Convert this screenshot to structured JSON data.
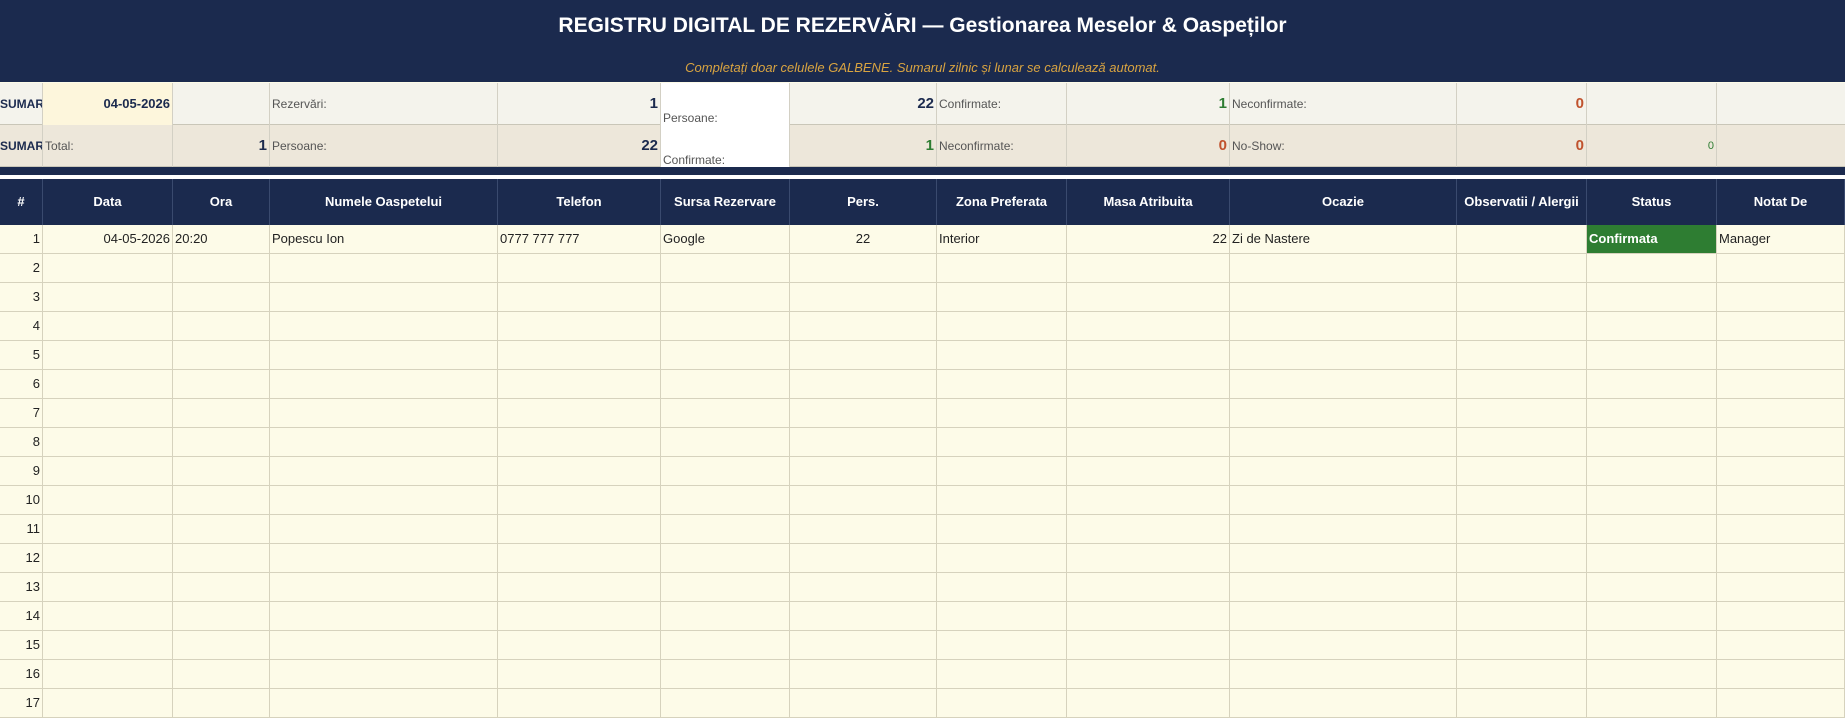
{
  "title": "REGISTRU DIGITAL DE REZERVĂRI  —  Gestionarea Meselor & Oaspeților",
  "subtitle": "Completați doar celulele GALBENE. Sumarul zilnic și lunar se calculează automat.",
  "summary_daily": {
    "label": "SUMAR",
    "date": "04-05-2026",
    "rezervari_label": "Rezervări:",
    "rezervari_value": "1",
    "persoane_label": "Persoane:",
    "persoane_value": "22",
    "confirmate_label": "Confirmate:",
    "confirmate_value": "1",
    "neconfirmate_label": "Neconfirmate:",
    "neconfirmate_value": "0"
  },
  "summary_monthly": {
    "label": "SUMAR",
    "total_label": "Total:",
    "total_value": "1",
    "persoane_label": "Persoane:",
    "persoane_value": "22",
    "confirmate_label": "Confirmate:",
    "confirmate_value": "1",
    "neconfirmate_label": "Neconfirmate:",
    "neconfirmate_value": "0",
    "noshow_label": "No-Show:",
    "noshow_value": "0",
    "extra_value": "0"
  },
  "columns": [
    "#",
    "Data",
    "Ora",
    "Numele Oaspetelui",
    "Telefon",
    "Sursa Rezervare",
    "Pers.",
    "Zona Preferata",
    "Masa Atribuita",
    "Ocazie",
    "Observatii / Alergii",
    "Status",
    "Notat De"
  ],
  "rows": [
    {
      "num": "1",
      "data": "04-05-2026",
      "ora": "20:20",
      "nume": "Popescu Ion",
      "telefon": "0777 777 777",
      "sursa": "Google",
      "pers": "22",
      "zona": "Interior",
      "masa": "22",
      "ocazie": "Zi de Nastere",
      "observatii": "",
      "status": "Confirmata",
      "notat": "Manager"
    },
    {
      "num": "2"
    },
    {
      "num": "3"
    },
    {
      "num": "4"
    },
    {
      "num": "5"
    },
    {
      "num": "6"
    },
    {
      "num": "7"
    },
    {
      "num": "8"
    },
    {
      "num": "9"
    },
    {
      "num": "10"
    },
    {
      "num": "11"
    },
    {
      "num": "12"
    },
    {
      "num": "13"
    },
    {
      "num": "14"
    },
    {
      "num": "15"
    },
    {
      "num": "16"
    },
    {
      "num": "17"
    }
  ],
  "colors": {
    "header": "#1b2a4e",
    "subtitle": "#d9a441",
    "confirmed": "#2e7d32",
    "warning": "#c0522d",
    "input": "#fdfbe8"
  }
}
